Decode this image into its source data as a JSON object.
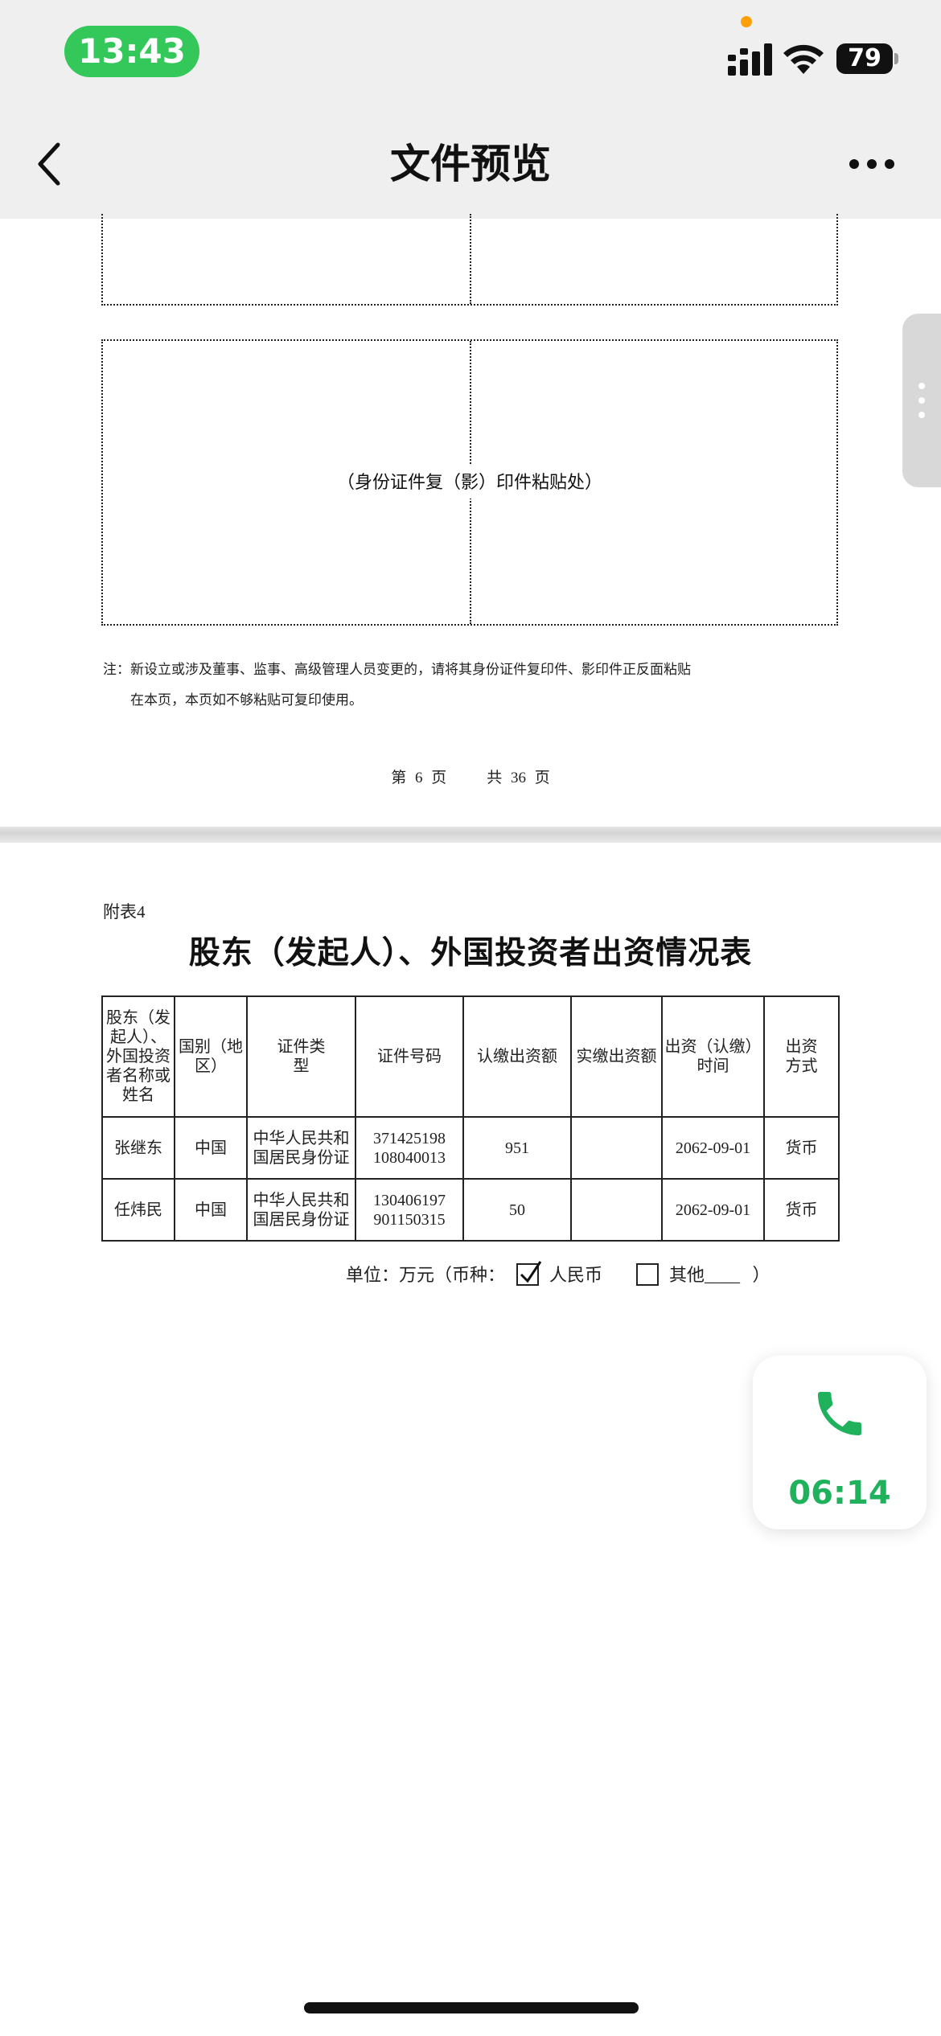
{
  "status_bar": {
    "time": "13:43",
    "battery": "79",
    "icons": [
      "signal-icon",
      "wifi-icon",
      "battery-icon"
    ]
  },
  "nav": {
    "title": "文件预览",
    "icons": [
      "back-icon",
      "more-icon"
    ]
  },
  "page6": {
    "paste_label": "（身份证件复（影）印件粘贴处）",
    "note_line1": "注：新设立或涉及董事、监事、高级管理人员变更的，请将其身份证件复印件、影印件正反面粘贴",
    "note_line2": "在本页，本页如不够粘贴可复印使用。",
    "page_current": "第 6 页",
    "page_total": "共 36 页"
  },
  "page7": {
    "appendix": "附表4",
    "title": "股东（发起人）、外国投资者出资情况表",
    "columns": [
      "股东（发起人）、外国投资者名称或姓名",
      "国别（地区）",
      "证件类型",
      "证件号码",
      "认缴出资额",
      "实缴出资额",
      "出资（认缴）时间",
      "出资方式"
    ],
    "rows": [
      [
        "张继东",
        "中国",
        "中华人民共和国居民身份证",
        "371425198108040013",
        "951",
        "",
        "2062-09-01",
        "货币"
      ],
      [
        "任炜民",
        "中国",
        "中华人民共和国居民身份证",
        "130406197901150315",
        "50",
        "",
        "2062-09-01",
        "货币"
      ]
    ],
    "unit_prefix": "单位：万元（币种：",
    "currency_rmb": "人民币",
    "currency_other": "其他____",
    "unit_suffix": "）",
    "rmb_checked": true
  },
  "call_widget": {
    "duration": "06:14",
    "icon": "phone-icon",
    "color": "#1fb15c"
  },
  "colors": {
    "status_pill": "#34c759",
    "chrome_bg": "#efefef"
  }
}
